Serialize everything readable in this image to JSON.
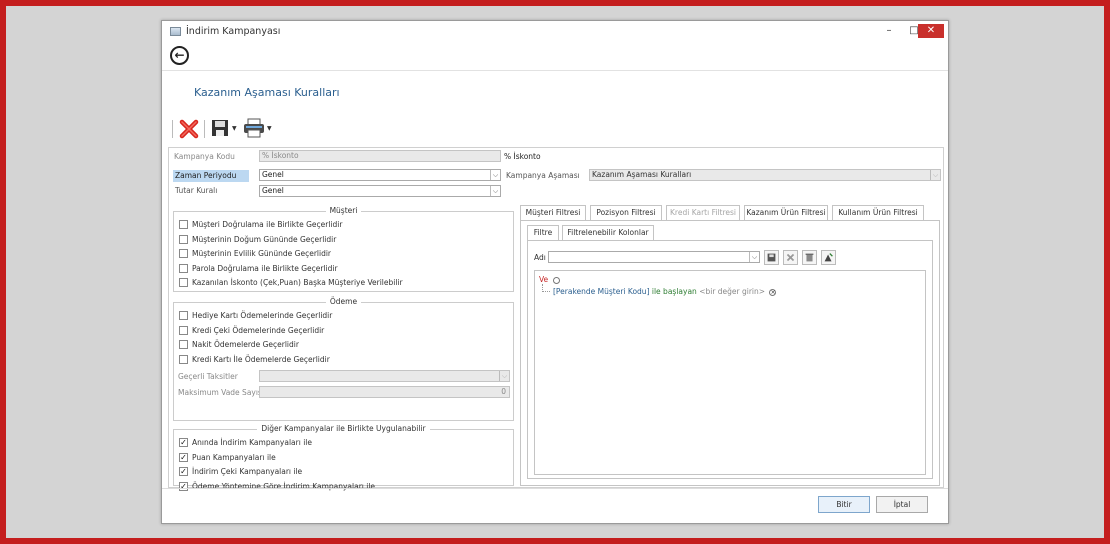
{
  "window": {
    "title": "İndirim Kampanyası",
    "min_glyph": "–",
    "max_glyph": "□",
    "close_glyph": "✕"
  },
  "page_title": "Kazanım Aşaması Kuralları",
  "icons": {
    "back": "arrow-left-circle-icon",
    "delete": "red-x-delete-icon",
    "save": "floppy-save-icon",
    "print": "printer-icon"
  },
  "form": {
    "kampanya_kodu": {
      "label": "Kampanya Kodu",
      "value": "% İskonto",
      "desc": "% İskonto"
    },
    "zaman_periyodu": {
      "label": "Zaman Periyodu",
      "value": "Genel"
    },
    "tutar_kurali": {
      "label": "Tutar Kuralı",
      "value": "Genel"
    },
    "kampanya_asamasi": {
      "label": "Kampanya Aşaması",
      "value": "Kazanım Aşaması Kuralları"
    }
  },
  "musteri": {
    "title": "Müşteri",
    "items": [
      {
        "label": "Müşteri Doğrulama ile Birlikte Geçerlidir",
        "checked": false
      },
      {
        "label": "Müşterinin Doğum Gününde Geçerlidir",
        "checked": false
      },
      {
        "label": "Müşterinin Evlilik Gününde Geçerlidir",
        "checked": false
      },
      {
        "label": "Parola Doğrulama ile Birlikte Geçerlidir",
        "checked": false
      },
      {
        "label": "Kazanılan İskonto (Çek,Puan) Başka Müşteriye Verilebilir",
        "checked": false
      }
    ]
  },
  "odeme": {
    "title": "Ödeme",
    "items": [
      {
        "label": "Hediye Kartı Ödemelerinde Geçerlidir",
        "checked": false
      },
      {
        "label": "Kredi Çeki Ödemelerinde Geçerlidir",
        "checked": false
      },
      {
        "label": "Nakit Ödemelerde Geçerlidir",
        "checked": false
      },
      {
        "label": "Kredi Kartı İle Ödemelerde Geçerlidir",
        "checked": false
      }
    ],
    "gecerli_taksitler": {
      "label": "Geçerli Taksitler",
      "value": ""
    },
    "maksimum_vade": {
      "label": "Maksimum Vade Sayısı",
      "value": "0"
    }
  },
  "diger": {
    "title": "Diğer Kampanyalar ile Birlikte Uygulanabilir",
    "items": [
      {
        "label": "Anında İndirim Kampanyaları ile",
        "checked": true
      },
      {
        "label": "Puan Kampanyaları ile",
        "checked": true
      },
      {
        "label": "İndirim Çeki Kampanyaları ile",
        "checked": true
      },
      {
        "label": "Ödeme Yöntemine Göre İndirim Kampanyaları ile",
        "checked": true
      }
    ]
  },
  "tabs": [
    {
      "label": "Müşteri Filtresi",
      "active": true,
      "disabled": false
    },
    {
      "label": "Pozisyon Filtresi",
      "active": false,
      "disabled": false
    },
    {
      "label": "Kredi Kartı Filtresi",
      "active": false,
      "disabled": true
    },
    {
      "label": "Kazanım Ürün Filtresi",
      "active": false,
      "disabled": false
    },
    {
      "label": "Kullanım Ürün Filtresi",
      "active": false,
      "disabled": false
    }
  ],
  "subtabs": [
    {
      "label": "Filtre",
      "active": true
    },
    {
      "label": "Filtrelenebilir Kolonlar",
      "active": false
    }
  ],
  "filter": {
    "adi_label": "Adı",
    "adi_value": "",
    "root": "Ve",
    "condition": {
      "field": "[Perakende Müşteri Kodu]",
      "operator": "ile başlayan",
      "value": "<bir değer girin>"
    }
  },
  "buttons": {
    "ok": "Bitir",
    "cancel": "İptal"
  },
  "colors": {
    "accent": "#2b5f8f",
    "frame": "#c41e1e",
    "highlight": "#bcd8f1",
    "operator": "#2e7d32",
    "root": "#c62828"
  }
}
